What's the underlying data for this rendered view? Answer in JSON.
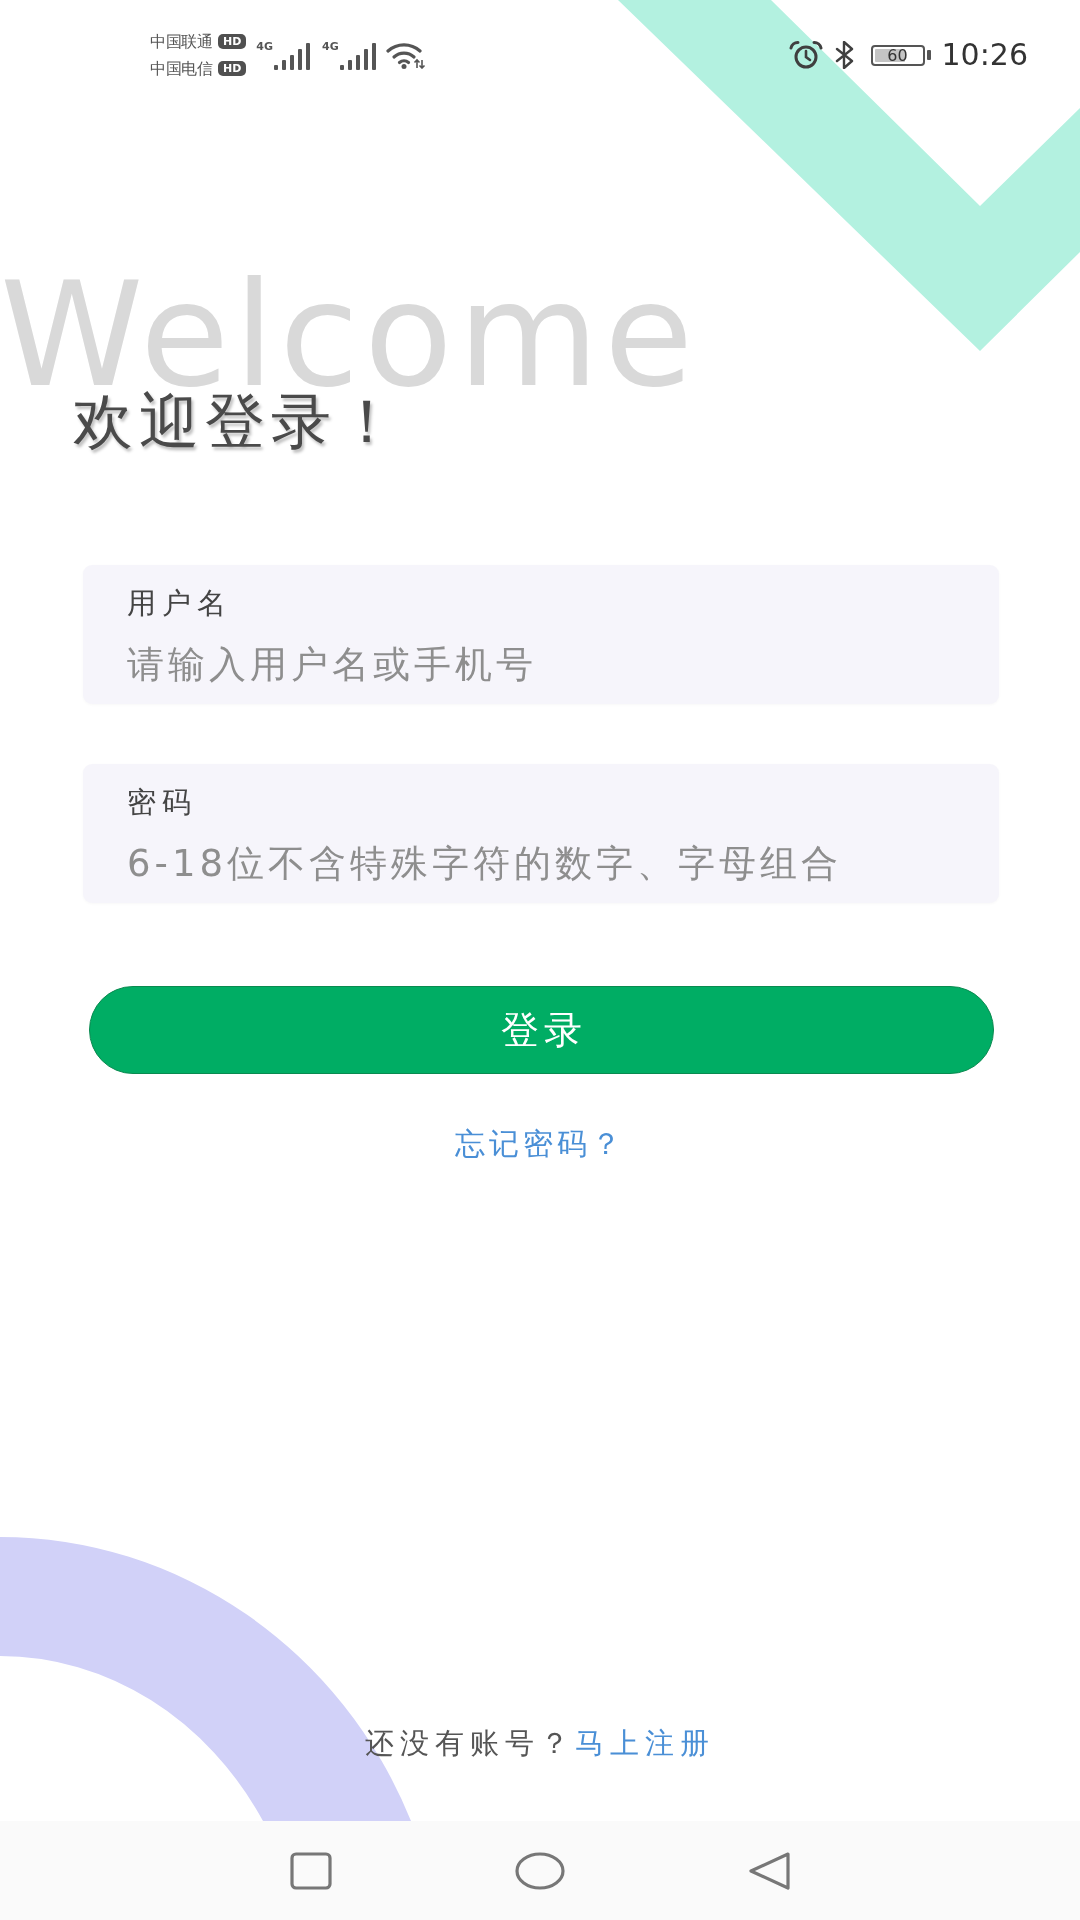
{
  "status_bar": {
    "carriers": [
      {
        "name": "中国联通",
        "badge": "HD"
      },
      {
        "name": "中国电信",
        "badge": "HD"
      }
    ],
    "networks": [
      {
        "label": "4G"
      },
      {
        "label": "4G"
      }
    ],
    "battery": "60",
    "time": "10:26"
  },
  "background_word": "Welcome",
  "title": "欢迎登录！",
  "fields": [
    {
      "label": "用户名",
      "placeholder": "请输入用户名或手机号"
    },
    {
      "label": "密码",
      "placeholder": "6-18位不含特殊字符的数字、字母组合"
    }
  ],
  "login_button": "登录",
  "forgot_password_link": "忘记密码？",
  "register": {
    "prompt": "还没有账号？",
    "link": "马上注册"
  }
}
